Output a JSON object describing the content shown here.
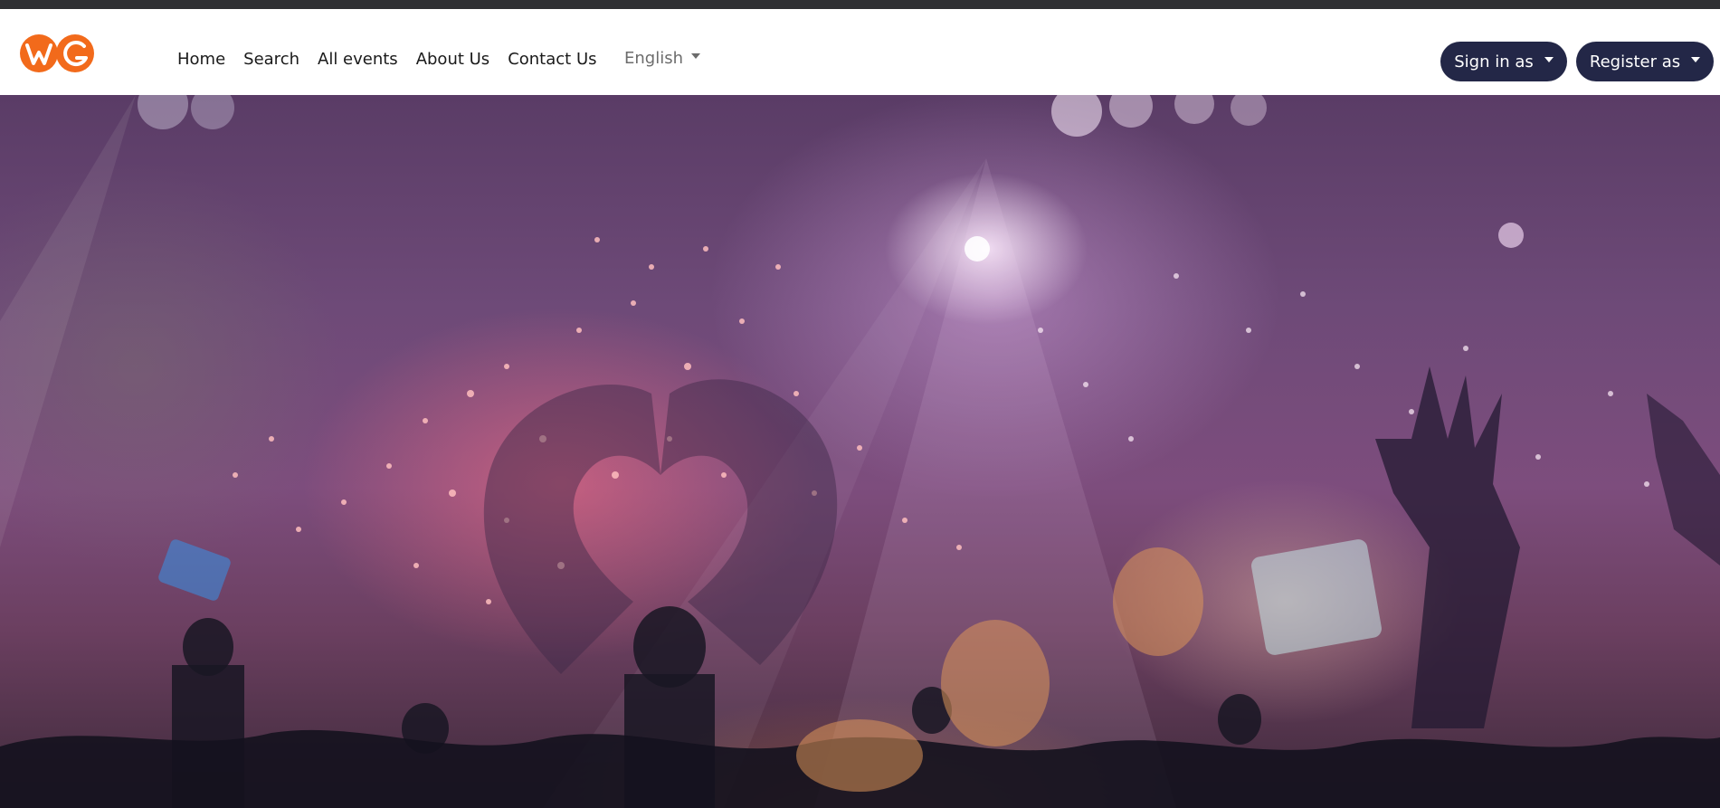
{
  "brand": {
    "logo_text": "WG",
    "logo_color": "#f26a1b"
  },
  "nav": {
    "links": [
      "Home",
      "Search",
      "All events",
      "About Us",
      "Contact Us"
    ]
  },
  "language": {
    "selected": "English"
  },
  "auth": {
    "sign_in_label": "Sign in as",
    "register_label": "Register as",
    "button_color": "#232747"
  },
  "hero": {
    "image": "concert-fireworks-crowd"
  }
}
